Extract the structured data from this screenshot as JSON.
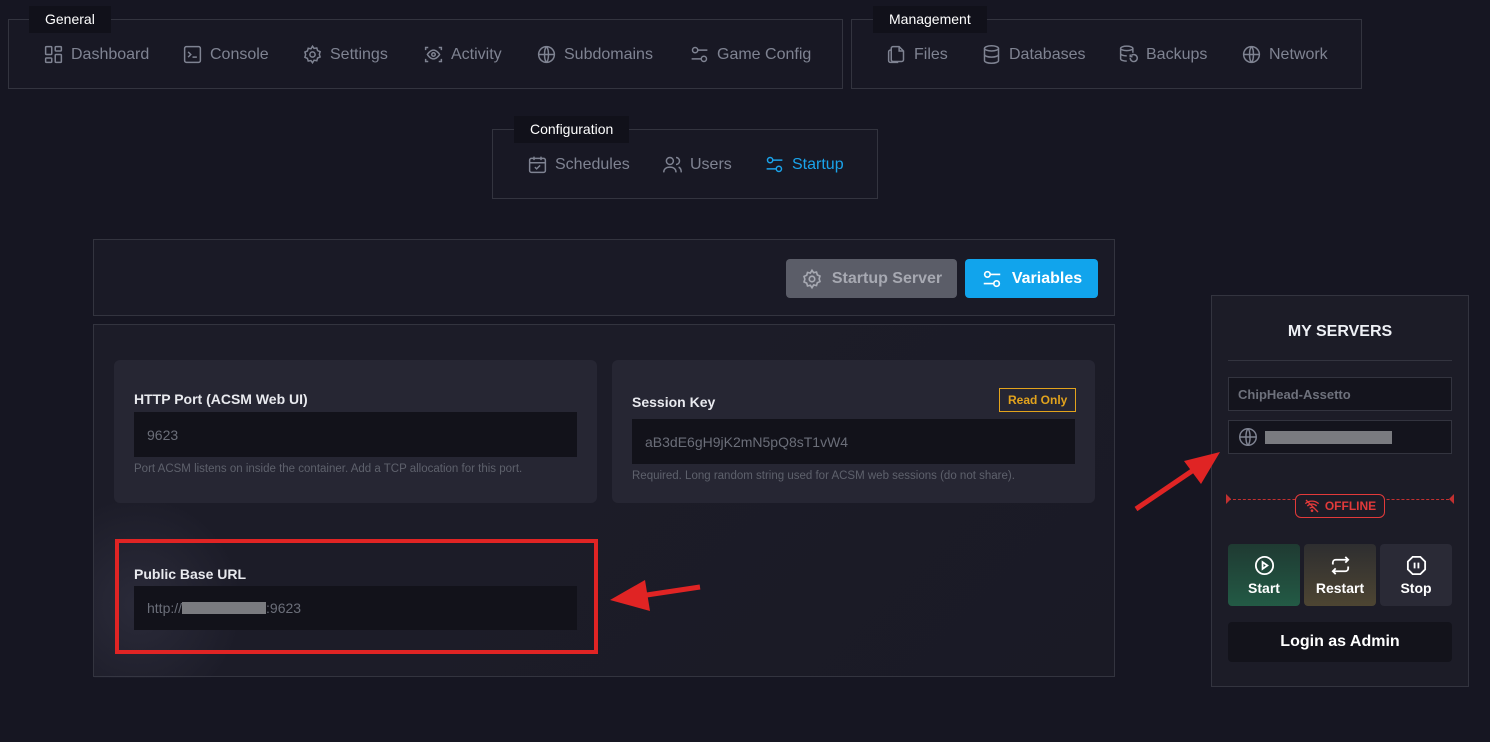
{
  "nav": {
    "general": {
      "label": "General",
      "items": [
        {
          "label": "Dashboard",
          "icon": "dashboard-icon"
        },
        {
          "label": "Console",
          "icon": "console-icon"
        },
        {
          "label": "Settings",
          "icon": "gear-icon"
        },
        {
          "label": "Activity",
          "icon": "eye-icon"
        },
        {
          "label": "Subdomains",
          "icon": "globe-icon"
        },
        {
          "label": "Game Config",
          "icon": "sliders-icon"
        }
      ]
    },
    "management": {
      "label": "Management",
      "items": [
        {
          "label": "Files",
          "icon": "files-icon"
        },
        {
          "label": "Databases",
          "icon": "database-icon"
        },
        {
          "label": "Backups",
          "icon": "backup-icon"
        },
        {
          "label": "Network",
          "icon": "globe-icon"
        }
      ]
    },
    "configuration": {
      "label": "Configuration",
      "items": [
        {
          "label": "Schedules",
          "icon": "calendar-icon"
        },
        {
          "label": "Users",
          "icon": "users-icon"
        },
        {
          "label": "Startup",
          "icon": "sliders-icon",
          "active": true
        }
      ]
    }
  },
  "toolbar": {
    "startup_server_label": "Startup Server",
    "variables_label": "Variables"
  },
  "variables": {
    "http_port": {
      "title": "HTTP Port (ACSM Web UI)",
      "value": "9623",
      "help": "Port ACSM listens on inside the container. Add a TCP allocation for this port."
    },
    "session_key": {
      "title": "Session Key",
      "badge": "Read Only",
      "value": "aB3dE6gH9jK2mN5pQ8sT1vW4",
      "help": "Required. Long random string used for ACSM web sessions (do not share)."
    },
    "public_base_url": {
      "title": "Public Base URL",
      "value_prefix": "http://",
      "value_suffix": ":9623"
    }
  },
  "sidebar": {
    "title": "MY SERVERS",
    "server_name": "ChipHead-Assetto",
    "status": "OFFLINE",
    "start_label": "Start",
    "restart_label": "Restart",
    "stop_label": "Stop",
    "login_label": "Login as Admin"
  },
  "colors": {
    "background": "#161622",
    "accent": "#11a4ec",
    "annotation_red": "#e02424",
    "status_offline": "#e23a3a",
    "read_only": "#e2a31d"
  }
}
